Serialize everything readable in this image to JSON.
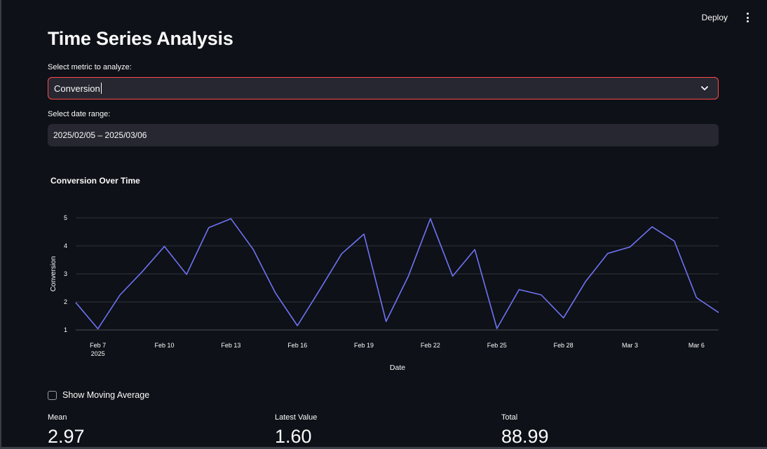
{
  "header": {
    "deploy_label": "Deploy",
    "menu_icon": "vertical-ellipsis-icon"
  },
  "page": {
    "title": "Time Series Analysis"
  },
  "metric_select": {
    "label": "Select metric to analyze:",
    "value": "Conversion",
    "icon": "chevron-down-icon"
  },
  "date_range": {
    "label": "Select date range:",
    "value": "2025/02/05 – 2025/03/06"
  },
  "chart_title": "Conversion Over Time",
  "chart_data": {
    "type": "line",
    "title": "",
    "xlabel": "Date",
    "ylabel": "Conversion",
    "ylim": [
      1,
      5
    ],
    "yticks": [
      1,
      2,
      3,
      4,
      5
    ],
    "grid": true,
    "line_color": "#6f73f3",
    "x_tick_labels": [
      {
        "date": "2025-02-07",
        "label": "Feb 7",
        "sublabel": "2025"
      },
      {
        "date": "2025-02-10",
        "label": "Feb 10"
      },
      {
        "date": "2025-02-13",
        "label": "Feb 13"
      },
      {
        "date": "2025-02-16",
        "label": "Feb 16"
      },
      {
        "date": "2025-02-19",
        "label": "Feb 19"
      },
      {
        "date": "2025-02-22",
        "label": "Feb 22"
      },
      {
        "date": "2025-02-25",
        "label": "Feb 25"
      },
      {
        "date": "2025-02-28",
        "label": "Feb 28"
      },
      {
        "date": "2025-03-03",
        "label": "Mar 3"
      },
      {
        "date": "2025-03-06",
        "label": "Mar 6"
      }
    ],
    "x": [
      "2025-02-06",
      "2025-02-07",
      "2025-02-08",
      "2025-02-09",
      "2025-02-10",
      "2025-02-11",
      "2025-02-12",
      "2025-02-13",
      "2025-02-14",
      "2025-02-15",
      "2025-02-16",
      "2025-02-17",
      "2025-02-18",
      "2025-02-19",
      "2025-02-20",
      "2025-02-21",
      "2025-02-22",
      "2025-02-23",
      "2025-02-24",
      "2025-02-25",
      "2025-02-26",
      "2025-02-27",
      "2025-02-28",
      "2025-03-01",
      "2025-03-02",
      "2025-03-03",
      "2025-03-04",
      "2025-03-05",
      "2025-03-06",
      "2025-03-07"
    ],
    "series": [
      {
        "values": [
          1.98,
          1.04,
          2.25,
          3.08,
          3.98,
          2.98,
          4.65,
          4.97,
          3.88,
          2.33,
          1.15,
          2.42,
          3.72,
          4.42,
          1.3,
          2.91,
          4.97,
          2.92,
          3.87,
          1.05,
          2.44,
          2.25,
          1.43,
          2.73,
          3.73,
          3.96,
          4.68,
          4.17,
          2.15,
          1.62
        ]
      }
    ]
  },
  "moving_average": {
    "label": "Show Moving Average",
    "checked": false
  },
  "metrics": [
    {
      "label": "Mean",
      "value": "2.97"
    },
    {
      "label": "Latest Value",
      "value": "1.60"
    },
    {
      "label": "Total",
      "value": "88.99"
    }
  ]
}
